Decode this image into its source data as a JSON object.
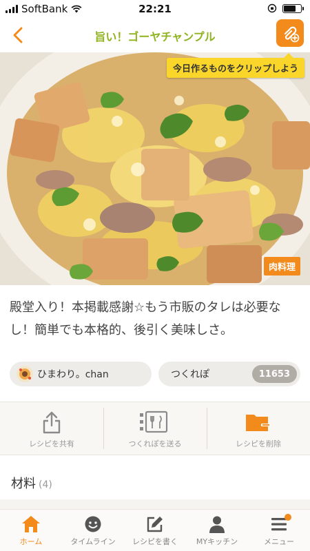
{
  "status_bar": {
    "carrier": "SoftBank",
    "time": "22:21",
    "battery_level": 0.75
  },
  "nav": {
    "title": "旨い！ゴーヤチャンプル"
  },
  "clip": {
    "tooltip": "今日作るものをクリップしよう",
    "icon": "clip-add-icon"
  },
  "recipe": {
    "category": "肉料理",
    "description": "殿堂入り！本掲載感謝☆もう市販のタレは必要なし！簡単でも本格的、後引く美味しさ。"
  },
  "author": {
    "name": "ひまわり。chan"
  },
  "tsukurepo": {
    "label": "つくれぽ",
    "count": "11653"
  },
  "actions": [
    {
      "label": "レシピを共有",
      "icon": "share-icon"
    },
    {
      "label": "つくれぽを送る",
      "icon": "send-tsukurepo-icon"
    },
    {
      "label": "レシピを削除",
      "icon": "delete-folder-icon"
    }
  ],
  "ingredients": {
    "title": "材料",
    "count": "(4)"
  },
  "tabs": [
    {
      "label": "ホーム",
      "icon": "home-icon",
      "active": true
    },
    {
      "label": "タイムライン",
      "icon": "smile-icon"
    },
    {
      "label": "レシピを書く",
      "icon": "pencil-icon"
    },
    {
      "label": "MYキッチン",
      "icon": "person-icon"
    },
    {
      "label": "メニュー",
      "icon": "menu-icon",
      "notification": true
    }
  ],
  "colors": {
    "accent": "#f28a1c",
    "title_green": "#8fb31f",
    "tooltip_yellow": "#fbd62a"
  }
}
